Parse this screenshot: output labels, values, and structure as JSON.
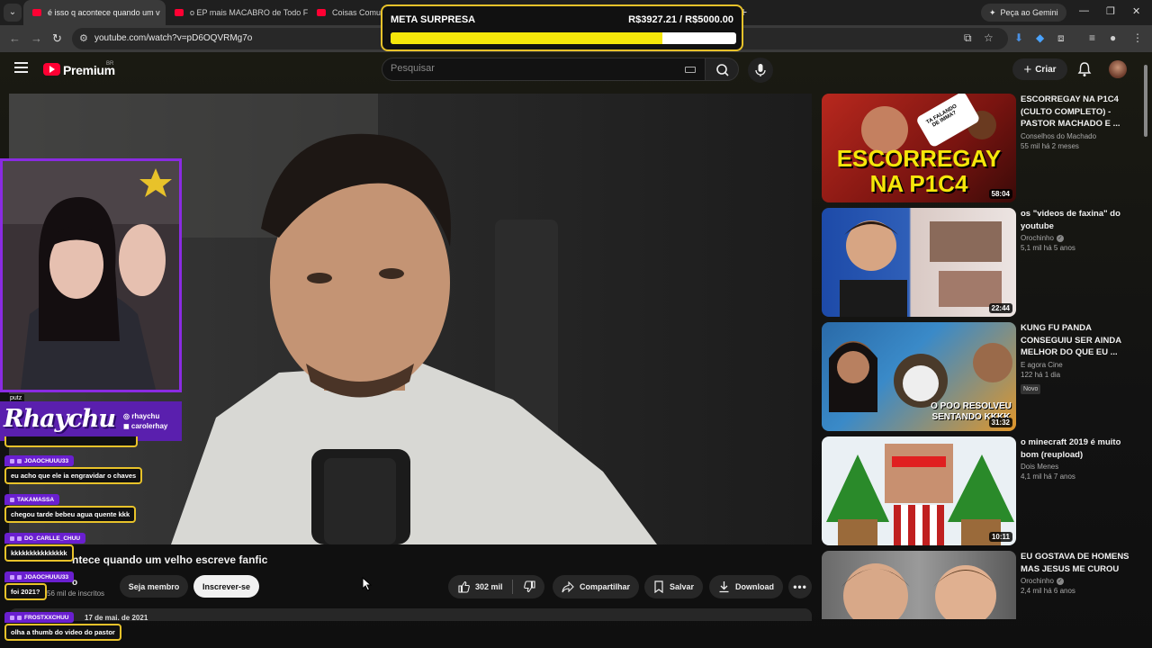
{
  "browser": {
    "tabs": [
      {
        "title": "é isso q acontece quando um v",
        "active": true
      },
      {
        "title": "o EP mais MACABRO de Todo F",
        "active": false
      },
      {
        "title": "Coisas Comuns",
        "active": false
      }
    ],
    "gemini_label": "Peça ao Gemini",
    "url": "youtube.com/watch?v=pD6OQVRMg7o"
  },
  "goal": {
    "title": "META SURPRESA",
    "value_text": "R$3927.21 / R$5000.00",
    "current": 3927.21,
    "target": 5000.0,
    "colors": {
      "border": "#e8c22a",
      "fill": "#f5e60a"
    }
  },
  "youtube": {
    "logo_text": "Premium",
    "country_code": "BR",
    "search_placeholder": "Pesquisar",
    "create_label": "Criar"
  },
  "video": {
    "title": "ntece quando um velho escreve fanfic",
    "channel_name": "o",
    "subscribers": "56 mil de inscritos",
    "member_label": "Seja membro",
    "subscribe_label": "Inscrever-se",
    "likes": "302 mil",
    "share_label": "Compartilhar",
    "save_label": "Salvar",
    "download_label": "Download",
    "description_preview": "17 de mai. de 2021"
  },
  "sidebar": {
    "items": [
      {
        "title": "ESCORREGAY NA P1C4 (CULTO COMPLETO) - PASTOR MACHADO E ...",
        "channel": "Conselhos do Machado",
        "verified": false,
        "stats": "55 mil  há 2 meses",
        "duration": "58:04",
        "badge": "",
        "thumb_text": "ESCORREGAY NA P1C4",
        "thumb_sticker": "TA FALANDO DE IMMA?"
      },
      {
        "title": "os \"videos de faxina\" do youtube",
        "channel": "Orochinho",
        "verified": true,
        "stats": "5,1 mil  há 5 anos",
        "duration": "22:44",
        "badge": "",
        "thumb_text": "",
        "thumb_sticker": ""
      },
      {
        "title": "KUNG FU PANDA CONSEGUIU SER AINDA MELHOR DO QUE EU ...",
        "channel": "E agora Cine",
        "verified": false,
        "stats": "122  há 1 dia",
        "duration": "31:32",
        "badge": "Novo",
        "thumb_text": "O POO RESOLVEU SENTANDO KKKK",
        "thumb_sticker": ""
      },
      {
        "title": "o minecraft 2019 é muito bom (reupload)",
        "channel": "Dois Menes",
        "verified": false,
        "stats": "4,1 mil  há 7 anos",
        "duration": "10:11",
        "badge": "",
        "thumb_text": "",
        "thumb_sticker": ""
      },
      {
        "title": "EU GOSTAVA DE HOMENS MAS JESUS ME CUROU",
        "channel": "Orochinho",
        "verified": true,
        "stats": "2,4 mil  há 6 anos",
        "duration": "",
        "badge": "",
        "thumb_text": "",
        "thumb_sticker": ""
      }
    ]
  },
  "stream_overlay": {
    "brand_name": "Rhaychu",
    "handles": [
      "rhaychu",
      "carolerhay"
    ],
    "putz_text": "putz",
    "chat": [
      {
        "user": "JOAOCHUUU33",
        "text": "eu acho que ele ia engravidar o chaves"
      },
      {
        "user": "TAKAMASSA",
        "text": "chegou tarde bebeu agua quente kkk"
      },
      {
        "user": "DO_CARLLE_CHUU",
        "text": "kkkkkkkkkkkkkkk"
      },
      {
        "user": "JOAOCHUUU33",
        "text": "foi 2021?"
      },
      {
        "user": "FROSTXXCHUU",
        "text": "olha a thumb do video do pastor"
      }
    ]
  }
}
